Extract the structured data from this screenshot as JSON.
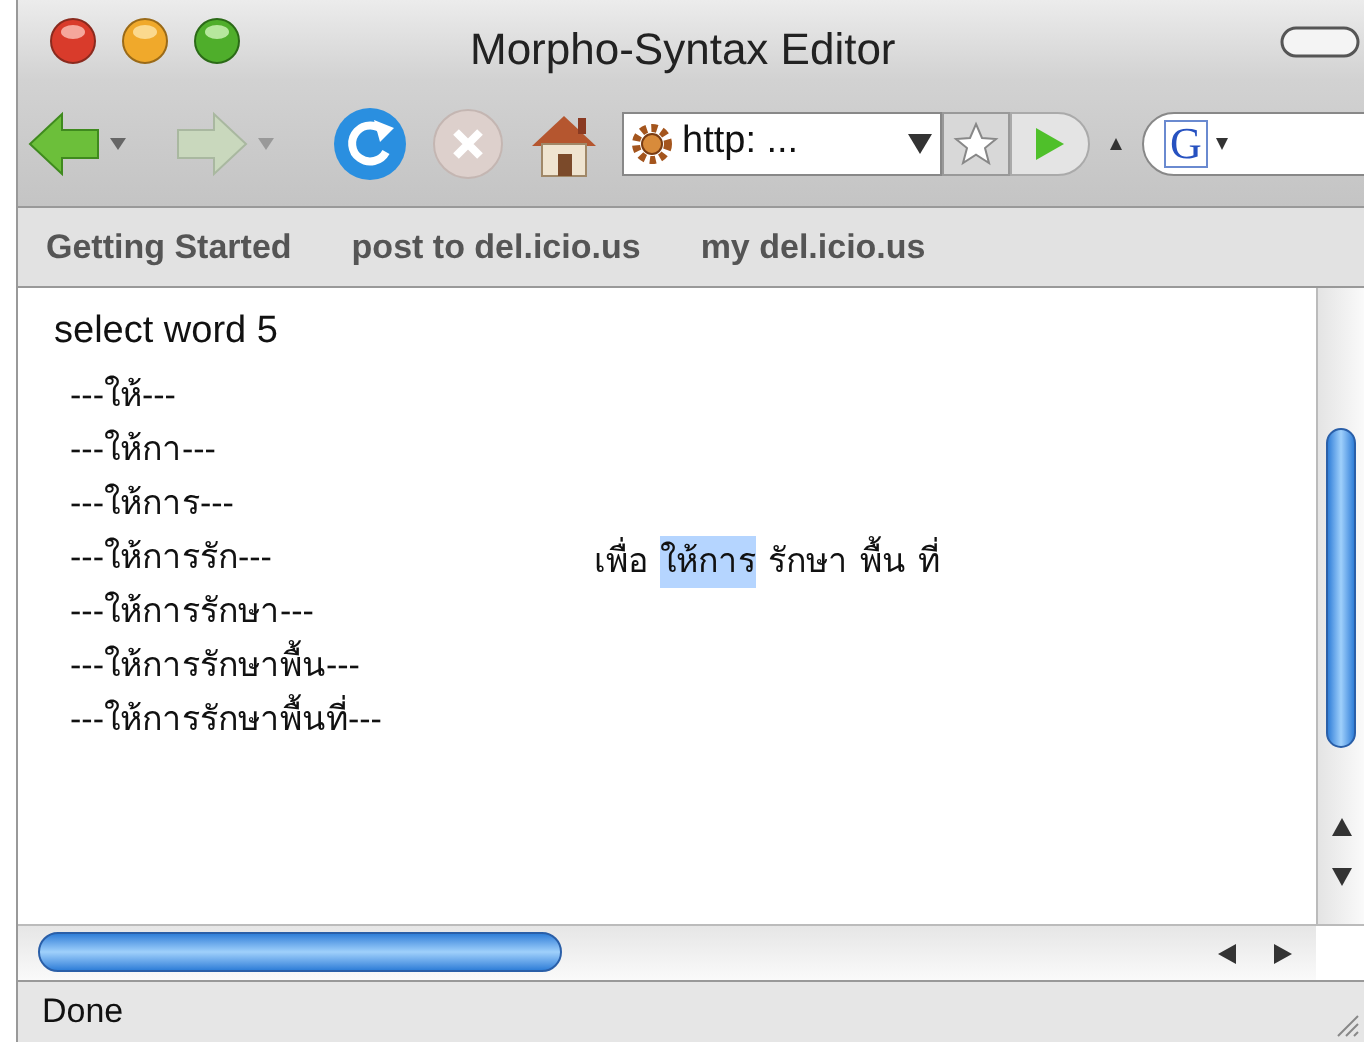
{
  "window": {
    "title": "Morpho-Syntax Editor"
  },
  "toolbar": {
    "url": "http: ...",
    "search_engine": "G"
  },
  "bookmarks": [
    "Getting Started",
    "post to del.icio.us",
    "my del.icio.us"
  ],
  "content": {
    "heading": "select word 5",
    "candidates": [
      "---ให้---",
      "---ให้กา---",
      "---ให้การ---",
      "---ให้การรัก---",
      "---ให้การรักษา---",
      "---ให้การรักษาพื้น---",
      "---ให้การรักษาพื้นที่---"
    ],
    "sentence": [
      {
        "text": "เพื่อ",
        "selected": false
      },
      {
        "text": "ให้การ",
        "selected": true
      },
      {
        "text": "รักษา",
        "selected": false
      },
      {
        "text": "พื้น",
        "selected": false
      },
      {
        "text": "ที่",
        "selected": false
      }
    ]
  },
  "status_bar": {
    "text": "Done"
  }
}
